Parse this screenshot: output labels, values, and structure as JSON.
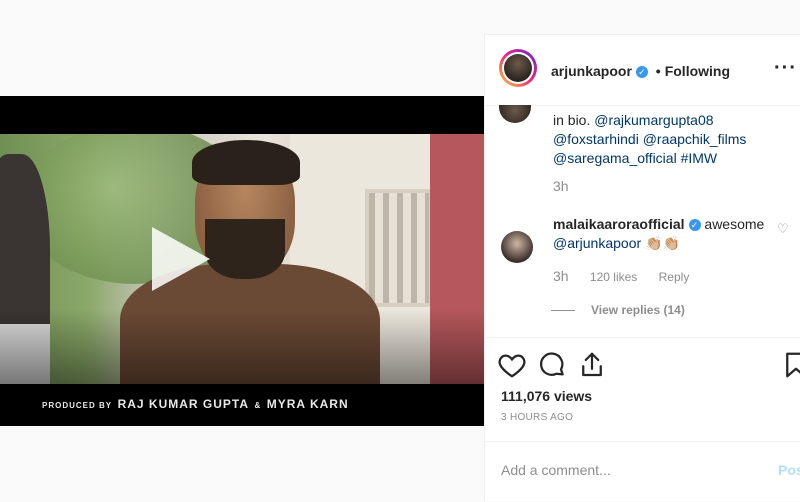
{
  "video": {
    "credit_prefix": "PRODUCED BY",
    "credit_names": "RAJ KUMAR GUPTA",
    "credit_amp": "&",
    "credit_names2": "MYRA KARN"
  },
  "post": {
    "username": "arjunkapoor",
    "verified": "✓",
    "separator": "•",
    "follow_status": "Following",
    "more": "···"
  },
  "caption": {
    "line1_plain": "in bio.",
    "line1_mention": "@rajkumargupta08",
    "line2a": "@foxstarhindi",
    "line2b": "@raapchik_films",
    "line3a": "@saregama_official",
    "line3b": "#IMW",
    "time": "3h"
  },
  "comment": {
    "username": "malaikaaroraofficial",
    "verified": "✓",
    "text": "awesome",
    "mention": "@arjunkapoor",
    "emoji": "👏🏼👏🏼",
    "time": "3h",
    "likes": "120 likes",
    "reply": "Reply",
    "view_replies": "View replies (14)"
  },
  "stats": {
    "views": "111,076 views",
    "ago": "3 HOURS AGO"
  },
  "composer": {
    "placeholder": "Add a comment...",
    "post": "Post"
  },
  "icons": [
    "heart-icon",
    "comment-icon",
    "share-icon",
    "bookmark-icon",
    "play-icon",
    "more-icon",
    "verified-icon"
  ]
}
